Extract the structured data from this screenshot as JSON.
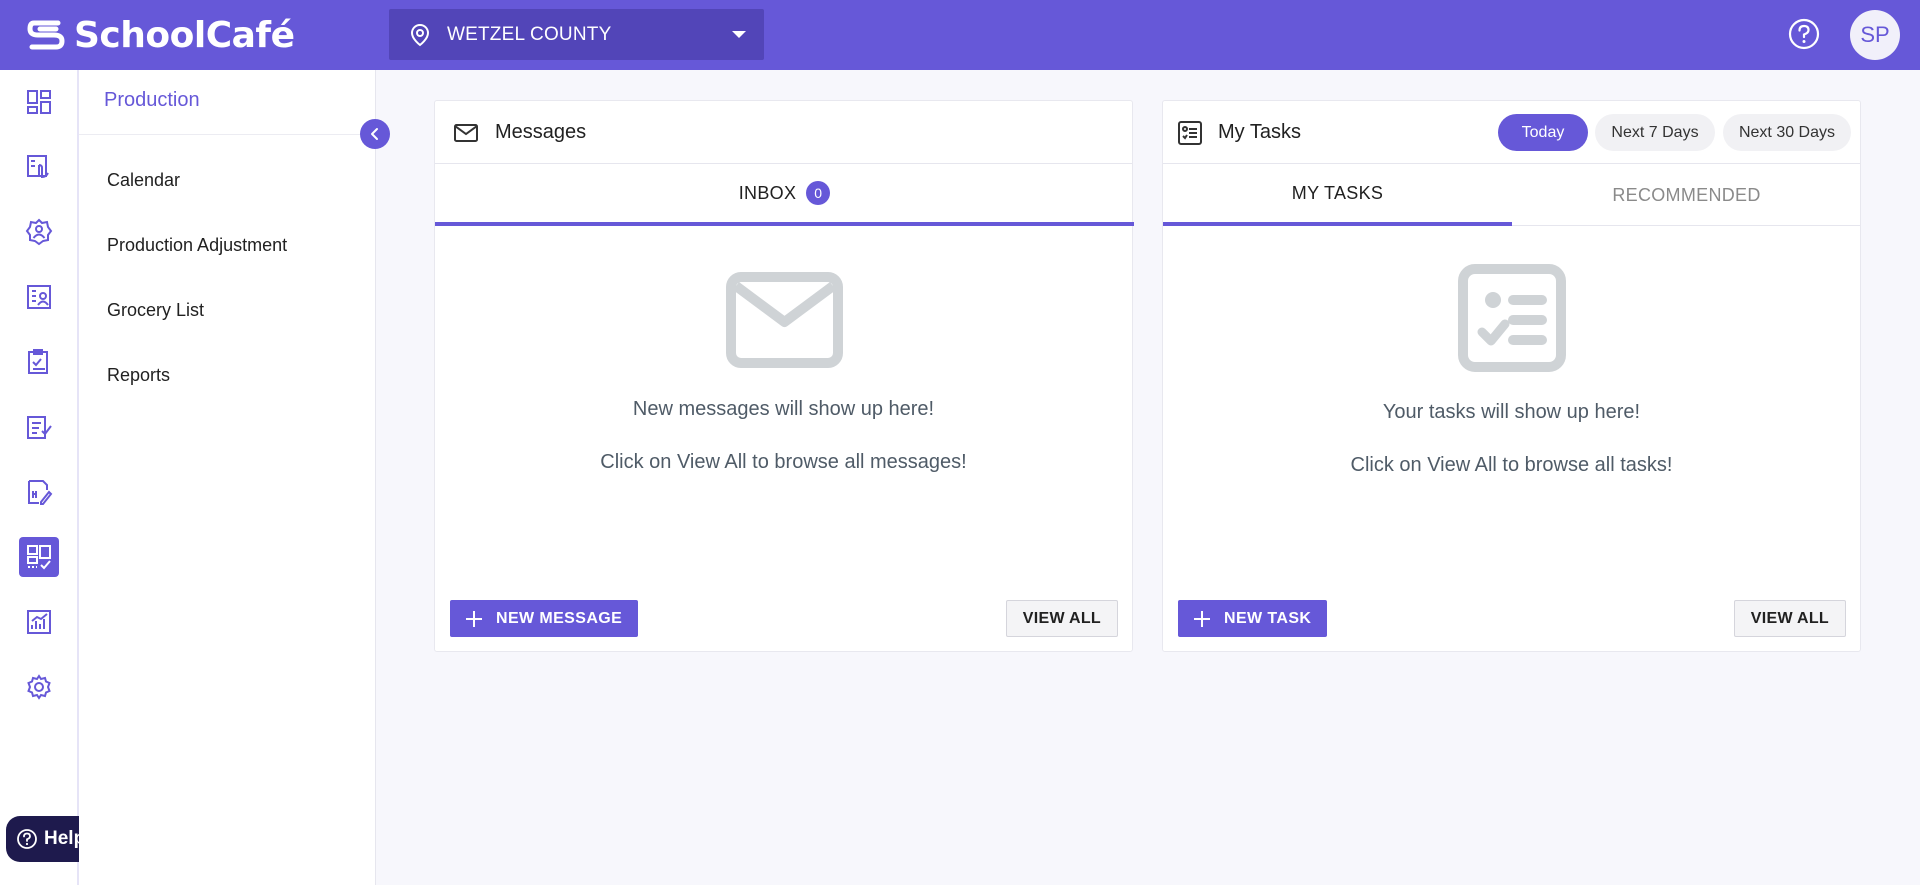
{
  "brand": {
    "name": "SchoolCafé"
  },
  "header": {
    "location": "WETZEL COUNTY",
    "help_icon": "question-circle-icon",
    "avatar_initials": "SP"
  },
  "colors": {
    "primary": "#6658d8",
    "primary_dark": "#5245b8",
    "help_bg": "#1e1a4d"
  },
  "rail": {
    "items": [
      {
        "icon": "dashboard-icon"
      },
      {
        "icon": "touch-board-icon"
      },
      {
        "icon": "user-gear-icon"
      },
      {
        "icon": "user-list-icon"
      },
      {
        "icon": "clipboard-check-icon"
      },
      {
        "icon": "checklist-icon"
      },
      {
        "icon": "menu-edit-icon"
      },
      {
        "icon": "production-icon",
        "active": true
      },
      {
        "icon": "reports-chart-icon"
      },
      {
        "icon": "settings-icon"
      }
    ],
    "help_label": "Help"
  },
  "subnav": {
    "title": "Production",
    "items": [
      {
        "label": "Calendar"
      },
      {
        "label": "Production Adjustment"
      },
      {
        "label": "Grocery List"
      },
      {
        "label": "Reports"
      }
    ]
  },
  "messages": {
    "title": "Messages",
    "tab_label": "INBOX",
    "tab_count": "0",
    "empty_line1": "New messages will show up here!",
    "empty_line2": "Click on View All to browse all messages!",
    "new_button": "NEW MESSAGE",
    "view_all": "VIEW ALL"
  },
  "tasks": {
    "title": "My Tasks",
    "filters": [
      "Today",
      "Next 7 Days",
      "Next 30 Days"
    ],
    "active_filter": "Today",
    "tabs": [
      "MY TASKS",
      "RECOMMENDED"
    ],
    "empty_line1": "Your tasks will show up here!",
    "empty_line2": "Click on View All to browse all tasks!",
    "new_button": "NEW TASK",
    "view_all": "VIEW ALL"
  }
}
